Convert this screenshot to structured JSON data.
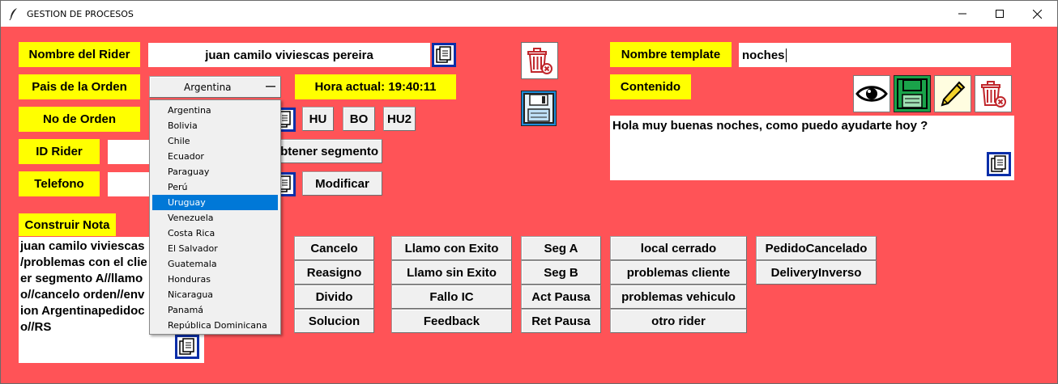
{
  "window": {
    "title": "GESTION DE PROCESOS",
    "controls": [
      "minimize-icon",
      "maximize-icon",
      "close-icon"
    ]
  },
  "left": {
    "rider_name_label": "Nombre del Rider",
    "rider_name_value": "juan camilo viviescas pereira",
    "country_label": "Pais de la Orden",
    "country_selected": "Argentina",
    "time_label": "Hora actual: 19:40:11",
    "order_label": "No de Orden",
    "order_value": "",
    "id_label": "ID Rider",
    "id_value": "",
    "phone_label": "Telefono",
    "phone_value": "",
    "hu_label": "HU",
    "bo_label": "BO",
    "hu2_label": "HU2",
    "segment_label": "btener segmento",
    "modify_label": "Modificar",
    "note_label": "Construir Nota",
    "note_lines": [
      "juan camilo viviescas",
      "/problemas con el clie",
      "er segmento A//llamo",
      "o//cancelo orden//env",
      "ion Argentinapedidoc",
      "o//RS"
    ]
  },
  "dropdown": {
    "options": [
      "Argentina",
      "Bolivia",
      "Chile",
      "Ecuador",
      "Paraguay",
      "Perú",
      "Uruguay",
      "Venezuela",
      "Costa Rica",
      "El Salvador",
      "Guatemala",
      "Honduras",
      "Nicaragua",
      "Panamá",
      "República Dominicana"
    ],
    "highlighted_index": 6
  },
  "actions": {
    "col1": [
      "Cancelo",
      "Reasigno",
      "Divido",
      "Solucion"
    ],
    "col2": [
      "Llamo con Exito",
      "Llamo sin Exito",
      "Fallo IC",
      "Feedback"
    ],
    "col3": [
      "Seg A",
      "Seg B",
      "Act Pausa",
      "Ret Pausa"
    ],
    "col4": [
      "local cerrado",
      "problemas cliente",
      "problemas vehiculo",
      "otro rider"
    ],
    "col5": [
      "PedidoCancelado",
      "DeliveryInverso"
    ]
  },
  "template": {
    "name_label": "Nombre template",
    "name_value": "noches",
    "content_label": "Contenido",
    "content_value": "Hola muy buenas noches, como puedo ayudarte hoy ?"
  },
  "colors": {
    "background": "#ff5357",
    "label": "#ffff00",
    "highlight": "#0078d7"
  }
}
